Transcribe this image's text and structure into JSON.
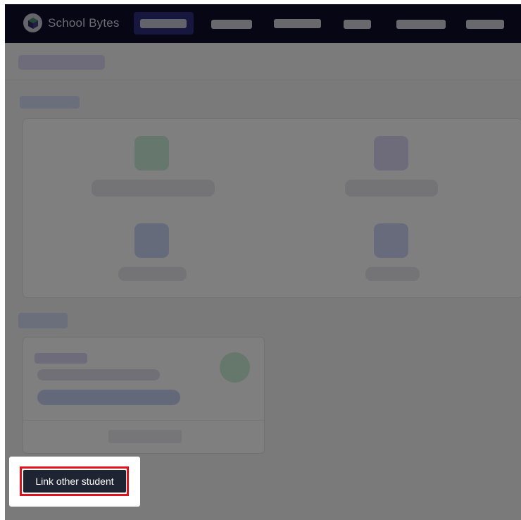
{
  "app": {
    "brand_name": "School Bytes",
    "logo_icon": "book-cube-icon"
  },
  "popup": {
    "link_button_label": "Link other student"
  },
  "colors": {
    "nav_background": "#0e0c2a",
    "nav_active": "#2e2d7c",
    "highlight_border": "#e0121b",
    "button_background": "#1f2433"
  }
}
